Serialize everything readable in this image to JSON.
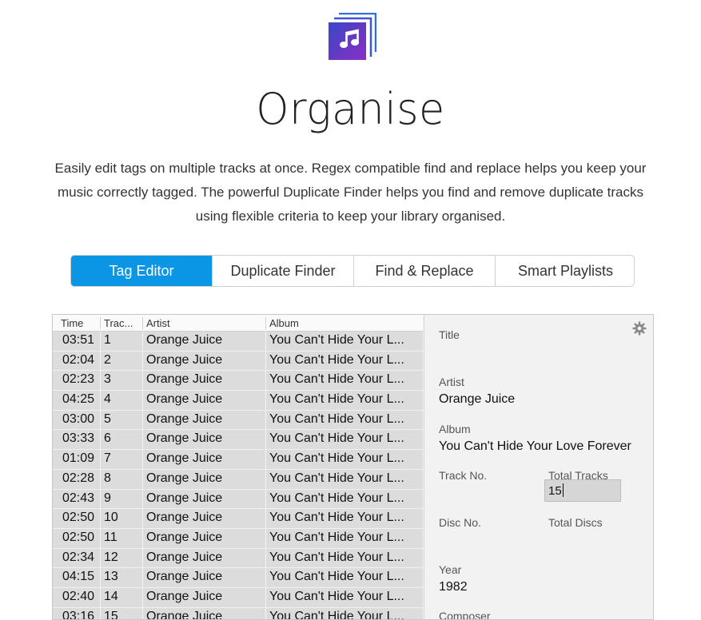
{
  "page": {
    "title": "Organise",
    "intro": "Easily edit tags on multiple tracks at once. Regex compatible find and replace helps you keep your music correctly tagged. The powerful Duplicate Finder helps you find and remove duplicate tracks using flexible criteria to keep your library organised.",
    "logo_icon": "music-note-icon"
  },
  "tabs": [
    {
      "label": "Tag Editor",
      "active": true
    },
    {
      "label": "Duplicate Finder",
      "active": false
    },
    {
      "label": "Find & Replace",
      "active": false
    },
    {
      "label": "Smart Playlists",
      "active": false
    }
  ],
  "colors": {
    "accent": "#0a96e4",
    "logo_start": "#3a46c8",
    "logo_end": "#8a2fc2"
  },
  "table": {
    "columns": [
      "Time",
      "Trac...",
      "Artist",
      "Album"
    ],
    "rows": [
      {
        "time": "03:51",
        "track": "1",
        "artist": "Orange Juice",
        "album": "You Can't Hide Your L..."
      },
      {
        "time": "02:04",
        "track": "2",
        "artist": "Orange Juice",
        "album": "You Can't Hide Your L..."
      },
      {
        "time": "02:23",
        "track": "3",
        "artist": "Orange Juice",
        "album": "You Can't Hide Your L..."
      },
      {
        "time": "04:25",
        "track": "4",
        "artist": "Orange Juice",
        "album": "You Can't Hide Your L..."
      },
      {
        "time": "03:00",
        "track": "5",
        "artist": "Orange Juice",
        "album": "You Can't Hide Your L..."
      },
      {
        "time": "03:33",
        "track": "6",
        "artist": "Orange Juice",
        "album": "You Can't Hide Your L..."
      },
      {
        "time": "01:09",
        "track": "7",
        "artist": "Orange Juice",
        "album": "You Can't Hide Your L..."
      },
      {
        "time": "02:28",
        "track": "8",
        "artist": "Orange Juice",
        "album": "You Can't Hide Your L..."
      },
      {
        "time": "02:43",
        "track": "9",
        "artist": "Orange Juice",
        "album": "You Can't Hide Your L..."
      },
      {
        "time": "02:50",
        "track": "10",
        "artist": "Orange Juice",
        "album": "You Can't Hide Your L..."
      },
      {
        "time": "02:50",
        "track": "11",
        "artist": "Orange Juice",
        "album": "You Can't Hide Your L..."
      },
      {
        "time": "02:34",
        "track": "12",
        "artist": "Orange Juice",
        "album": "You Can't Hide Your L..."
      },
      {
        "time": "04:15",
        "track": "13",
        "artist": "Orange Juice",
        "album": "You Can't Hide Your L..."
      },
      {
        "time": "02:40",
        "track": "14",
        "artist": "Orange Juice",
        "album": "You Can't Hide Your L..."
      },
      {
        "time": "03:16",
        "track": "15",
        "artist": "Orange Juice",
        "album": "You Can't Hide Your L..."
      }
    ]
  },
  "inspector": {
    "gear_icon": "gear-icon",
    "title_label": "Title",
    "title_value": "",
    "artist_label": "Artist",
    "artist_value": "Orange Juice",
    "album_label": "Album",
    "album_value": "You Can't Hide Your Love Forever",
    "track_no_label": "Track No.",
    "total_tracks_label": "Total Tracks",
    "total_tracks_value": "15",
    "disc_no_label": "Disc No.",
    "total_discs_label": "Total Discs",
    "year_label": "Year",
    "year_value": "1982",
    "composer_label": "Composer"
  }
}
